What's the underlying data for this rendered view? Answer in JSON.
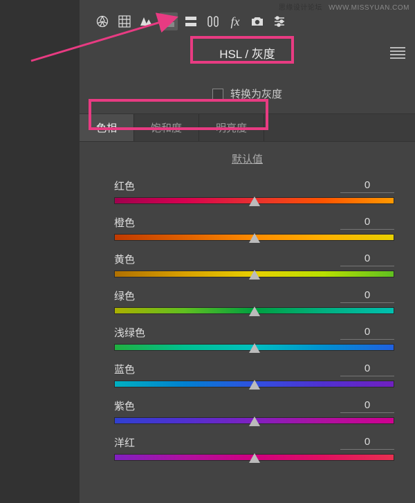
{
  "watermark": {
    "text1": "思缘设计论坛",
    "text2": "WWW.MISSYUAN.COM"
  },
  "panel_title": "HSL / 灰度",
  "convert_grayscale_label": "转换为灰度",
  "tabs": {
    "hue": "色相",
    "saturation": "饱和度",
    "luminance": "明亮度"
  },
  "default_label": "默认值",
  "sliders": [
    {
      "label": "红色",
      "value": "0",
      "gradient": "g-red"
    },
    {
      "label": "橙色",
      "value": "0",
      "gradient": "g-orange"
    },
    {
      "label": "黄色",
      "value": "0",
      "gradient": "g-yellow"
    },
    {
      "label": "绿色",
      "value": "0",
      "gradient": "g-green"
    },
    {
      "label": "浅绿色",
      "value": "0",
      "gradient": "g-aqua"
    },
    {
      "label": "蓝色",
      "value": "0",
      "gradient": "g-blue"
    },
    {
      "label": "紫色",
      "value": "0",
      "gradient": "g-purple"
    },
    {
      "label": "洋红",
      "value": "0",
      "gradient": "g-magenta"
    }
  ]
}
